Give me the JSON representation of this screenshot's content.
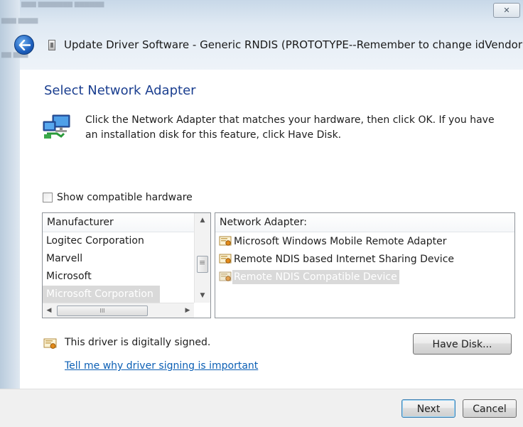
{
  "window": {
    "title": "Update Driver Software - Generic RNDIS (PROTOTYPE--Remember to change idVendor)",
    "close_glyph": "☒"
  },
  "page": {
    "heading": "Select Network Adapter",
    "description": "Click the Network Adapter that matches your hardware, then click OK. If you have an installation disk for this feature, click Have Disk."
  },
  "compatible": {
    "label": "Show compatible hardware",
    "checked": false
  },
  "manufacturer": {
    "header": "Manufacturer",
    "items": [
      "Logitec Corporation",
      "Marvell",
      "Microsoft",
      "Microsoft Corporation"
    ],
    "selected": "Microsoft Corporation"
  },
  "network_adapter": {
    "header": "Network Adapter:",
    "items": [
      "Microsoft Windows Mobile Remote Adapter",
      "Remote NDIS based Internet Sharing Device",
      "Remote NDIS Compatible Device"
    ],
    "selected": "Remote NDIS Compatible Device"
  },
  "signing": {
    "status": "This driver is digitally signed.",
    "link": "Tell me why driver signing is important"
  },
  "buttons": {
    "have_disk": "Have Disk...",
    "next": "Next",
    "cancel": "Cancel"
  },
  "colors": {
    "heading": "#1a3e8f",
    "link": "#0b5fb5",
    "selection": "#d9d9d9"
  }
}
